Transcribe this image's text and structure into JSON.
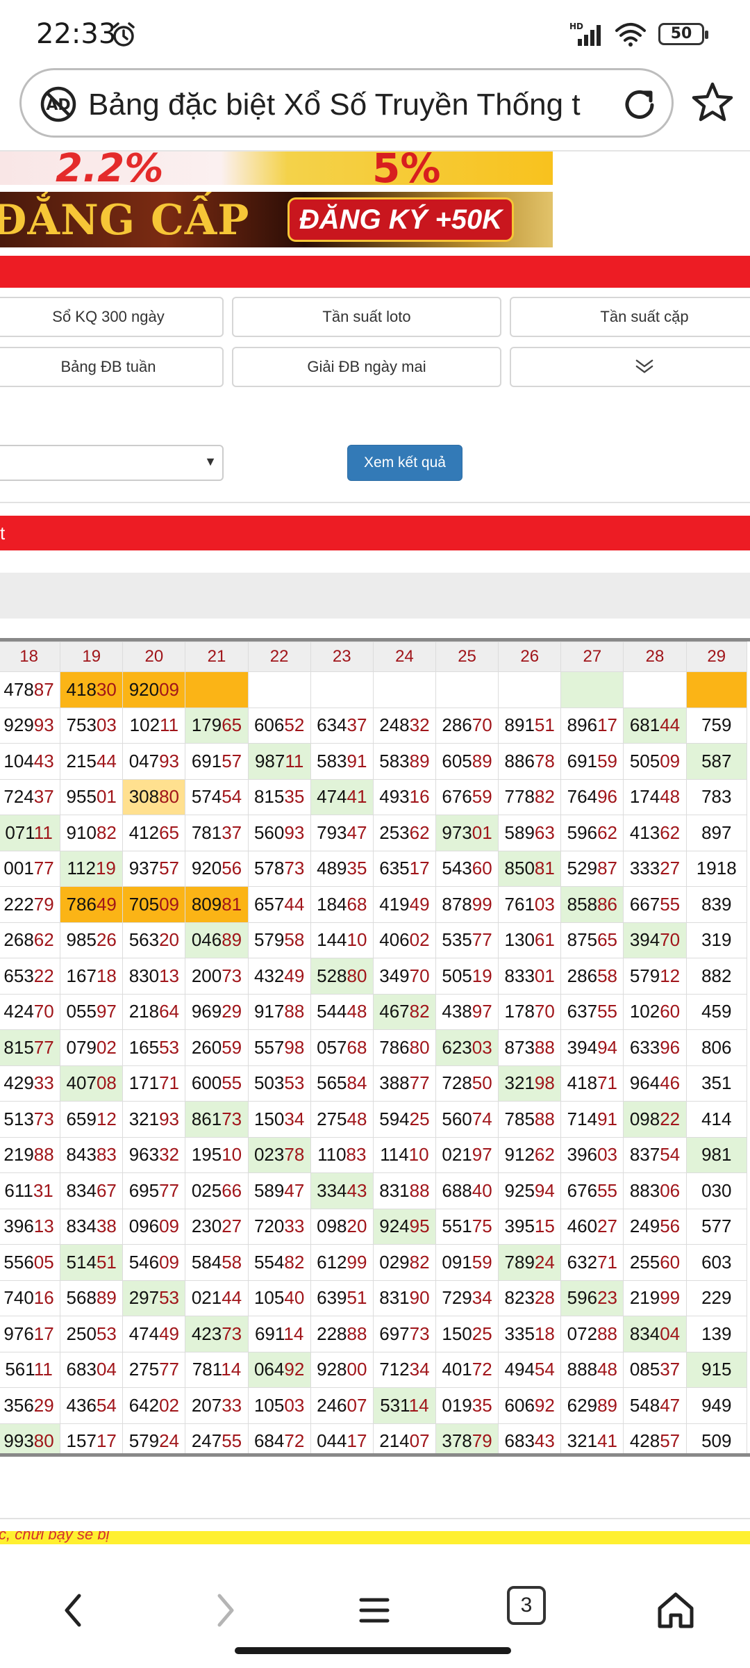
{
  "status": {
    "time": "22:33",
    "battery": "50",
    "network": "HD"
  },
  "browser": {
    "url_text": "Bảng đặc biệt Xổ Số Truyền Thống t",
    "tab_count": "3"
  },
  "banners": {
    "left_percent": "2.2%",
    "right_percent": "5%",
    "rank_text": "ĐẲNG CẤP",
    "cta": "ĐĂNG KÝ +50K"
  },
  "nav": {
    "row1": [
      "Sổ KQ 300 ngày",
      "Tần suất loto",
      "Tần suất cặp"
    ],
    "row2": [
      "Bảng ĐB tuần",
      "Giải ĐB ngày mai"
    ]
  },
  "form": {
    "submit_label": "Xem kết quả"
  },
  "section_letter": "t",
  "table": {
    "headers": [
      "18",
      "19",
      "20",
      "21",
      "22",
      "23",
      "24",
      "25",
      "26",
      "27",
      "28",
      "29"
    ],
    "rows": [
      [
        "47887",
        "41830",
        "92009",
        "",
        "",
        "",
        "",
        "",
        "",
        "",
        "",
        ""
      ],
      [
        "92993",
        "75303",
        "10211",
        "17965",
        "60652",
        "63437",
        "24832",
        "28670",
        "89151",
        "89617",
        "68144",
        "759"
      ],
      [
        "10443",
        "21544",
        "04793",
        "69157",
        "98711",
        "58391",
        "58389",
        "60589",
        "88678",
        "69159",
        "50509",
        "587"
      ],
      [
        "72437",
        "95501",
        "30880",
        "57454",
        "81535",
        "47441",
        "49316",
        "67659",
        "77882",
        "76496",
        "17448",
        "783"
      ],
      [
        "07111",
        "91082",
        "41265",
        "78137",
        "56093",
        "79347",
        "25362",
        "97301",
        "58963",
        "59662",
        "41362",
        "897"
      ],
      [
        "00177",
        "11219",
        "93757",
        "92056",
        "57873",
        "48935",
        "63517",
        "54360",
        "85081",
        "52987",
        "33327",
        "1918"
      ],
      [
        "22279",
        "78649",
        "70509",
        "80981",
        "65744",
        "18468",
        "41949",
        "87899",
        "76103",
        "85886",
        "66755",
        "839"
      ],
      [
        "26862",
        "98526",
        "56320",
        "04689",
        "57958",
        "14410",
        "40602",
        "53577",
        "13061",
        "87565",
        "39470",
        "319"
      ],
      [
        "65322",
        "16718",
        "83013",
        "20073",
        "43249",
        "52880",
        "34970",
        "50519",
        "83301",
        "28658",
        "57912",
        "882"
      ],
      [
        "42470",
        "05597",
        "21864",
        "96929",
        "91788",
        "54448",
        "46782",
        "43897",
        "17870",
        "63755",
        "10260",
        "459"
      ],
      [
        "81577",
        "07902",
        "16553",
        "26059",
        "55798",
        "05768",
        "78680",
        "62303",
        "87388",
        "39494",
        "63396",
        "806"
      ],
      [
        "42933",
        "40708",
        "17171",
        "60055",
        "50353",
        "56584",
        "38877",
        "72850",
        "32198",
        "41871",
        "96446",
        "351"
      ],
      [
        "51373",
        "65912",
        "32193",
        "86173",
        "15034",
        "27548",
        "59425",
        "56074",
        "78588",
        "71491",
        "09822",
        "414"
      ],
      [
        "21988",
        "84383",
        "96332",
        "19510",
        "02378",
        "11083",
        "11410",
        "02197",
        "91262",
        "39603",
        "83754",
        "981"
      ],
      [
        "61131",
        "83467",
        "69577",
        "02566",
        "58947",
        "33443",
        "83188",
        "68840",
        "92594",
        "67655",
        "88306",
        "030"
      ],
      [
        "39613",
        "83438",
        "09609",
        "23027",
        "72033",
        "09820",
        "92495",
        "55175",
        "39515",
        "46027",
        "24956",
        "577"
      ],
      [
        "55605",
        "51451",
        "54609",
        "58458",
        "55482",
        "61299",
        "02982",
        "09159",
        "78924",
        "63271",
        "25560",
        "603"
      ],
      [
        "74016",
        "56889",
        "29753",
        "02144",
        "10540",
        "63951",
        "83190",
        "72934",
        "82328",
        "59623",
        "21999",
        "229"
      ],
      [
        "97617",
        "25053",
        "47449",
        "42373",
        "69114",
        "22888",
        "69773",
        "15025",
        "33518",
        "07288",
        "83404",
        "139"
      ],
      [
        "56111",
        "68304",
        "27577",
        "78114",
        "06492",
        "92800",
        "71234",
        "40172",
        "49454",
        "88848",
        "08537",
        "915"
      ],
      [
        "35629",
        "43654",
        "64202",
        "20733",
        "10503",
        "24607",
        "53114",
        "01935",
        "60692",
        "62989",
        "54847",
        "949"
      ],
      [
        "99380",
        "15717",
        "57924",
        "24755",
        "68472",
        "04417",
        "21407",
        "37879",
        "68343",
        "32141",
        "42857",
        "509"
      ]
    ],
    "highlights": {
      "0": {
        "1": "o",
        "2": "o",
        "3": "o",
        "9": "g",
        "11": "o"
      },
      "1": {
        "3": "g",
        "10": "g"
      },
      "2": {
        "4": "g",
        "11": "g"
      },
      "3": {
        "2": "y",
        "5": "g"
      },
      "4": {
        "0": "g",
        "7": "g"
      },
      "5": {
        "1": "g",
        "8": "g"
      },
      "6": {
        "1": "o",
        "2": "o",
        "3": "o",
        "9": "g"
      },
      "7": {
        "3": "g",
        "10": "g"
      },
      "8": {
        "5": "g"
      },
      "9": {
        "6": "g"
      },
      "10": {
        "0": "g",
        "7": "g"
      },
      "11": {
        "1": "g",
        "8": "g"
      },
      "12": {
        "3": "g",
        "10": "g"
      },
      "13": {
        "4": "g",
        "11": "g"
      },
      "14": {
        "5": "g"
      },
      "15": {
        "6": "g"
      },
      "16": {
        "1": "g",
        "8": "g"
      },
      "17": {
        "2": "g",
        "9": "g"
      },
      "18": {
        "3": "g",
        "10": "g"
      },
      "19": {
        "4": "g",
        "11": "g"
      },
      "20": {
        "6": "g"
      },
      "21": {
        "0": "g",
        "7": "g"
      }
    }
  },
  "footer": {
    "ticker_text": "c, chửi bậy sẽ bị"
  },
  "colors": {
    "red": "#ed1c24",
    "green_cell": "#e1f3d8",
    "orange_cell": "#fbb416",
    "yellow_cell": "#ffe08f",
    "button_blue": "#337ab7",
    "number_tail": "#a0151a"
  },
  "icons": [
    "alarm-icon",
    "signal-icon",
    "wifi-icon",
    "ad-block-icon",
    "reload-icon",
    "star-icon",
    "chevron-down-icon",
    "back-icon",
    "forward-icon",
    "menu-icon",
    "tabs-icon",
    "home-icon"
  ]
}
